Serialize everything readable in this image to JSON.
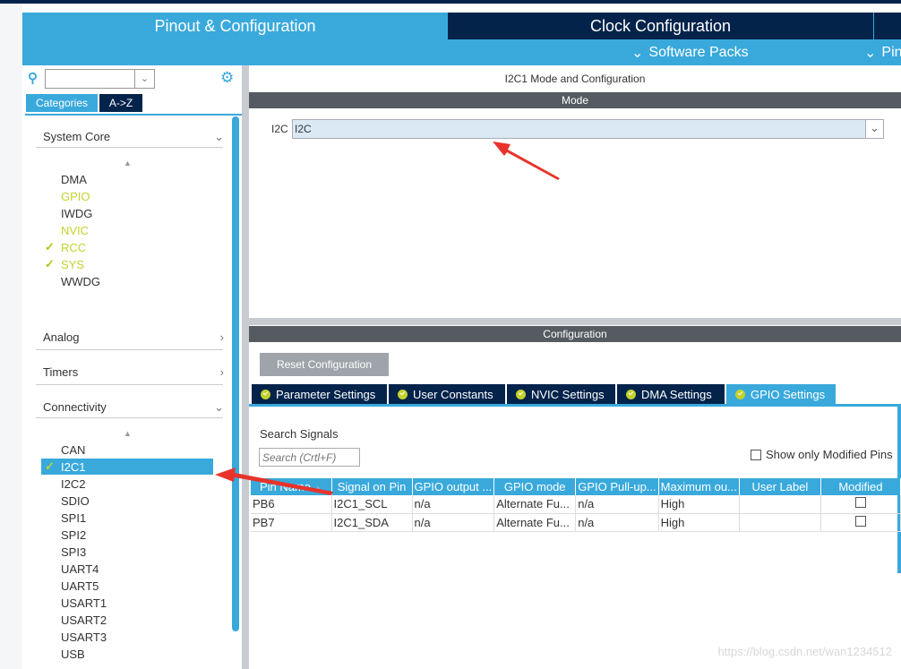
{
  "header": {
    "tabs": [
      {
        "label": "Pinout & Configuration",
        "active": true
      },
      {
        "label": "Clock Configuration",
        "active": false
      }
    ],
    "submenus": [
      "Software Packs",
      "Pin"
    ]
  },
  "left": {
    "search": {
      "value": "",
      "placeholder": ""
    },
    "view_tabs": [
      "Categories",
      "A->Z"
    ],
    "groups": [
      {
        "label": "System Core",
        "expanded": true,
        "items": [
          {
            "label": "DMA",
            "state": "normal"
          },
          {
            "label": "GPIO",
            "state": "partial"
          },
          {
            "label": "IWDG",
            "state": "normal"
          },
          {
            "label": "NVIC",
            "state": "partial"
          },
          {
            "label": "RCC",
            "state": "checked"
          },
          {
            "label": "SYS",
            "state": "checked"
          },
          {
            "label": "WWDG",
            "state": "normal"
          }
        ]
      },
      {
        "label": "Analog",
        "expanded": false
      },
      {
        "label": "Timers",
        "expanded": false
      },
      {
        "label": "Connectivity",
        "expanded": true,
        "items": [
          {
            "label": "CAN"
          },
          {
            "label": "I2C1",
            "selected": true,
            "checked": true
          },
          {
            "label": "I2C2"
          },
          {
            "label": "SDIO"
          },
          {
            "label": "SPI1"
          },
          {
            "label": "SPI2"
          },
          {
            "label": "SPI3"
          },
          {
            "label": "UART4"
          },
          {
            "label": "UART5"
          },
          {
            "label": "USART1"
          },
          {
            "label": "USART2"
          },
          {
            "label": "USART3"
          },
          {
            "label": "USB"
          }
        ]
      }
    ]
  },
  "main": {
    "title": "I2C1 Mode and Configuration",
    "mode_header": "Mode",
    "mode_label": "I2C",
    "mode_value": "I2C",
    "config_header": "Configuration",
    "reset_button": "Reset Configuration",
    "tabs": [
      "Parameter Settings",
      "User Constants",
      "NVIC Settings",
      "DMA Settings",
      "GPIO Settings"
    ],
    "active_tab": "GPIO Settings",
    "search_label": "Search Signals",
    "search_placeholder": "Search (Crtl+F)",
    "show_modified": "Show only Modified Pins",
    "columns": [
      "Pin Name",
      "Signal on Pin",
      "GPIO output ...",
      "GPIO mode",
      "GPIO Pull-up...",
      "Maximum ou...",
      "User Label",
      "Modified"
    ],
    "rows": [
      [
        "PB6",
        "I2C1_SCL",
        "n/a",
        "Alternate Fu...",
        "n/a",
        "High",
        "",
        false
      ],
      [
        "PB7",
        "I2C1_SDA",
        "n/a",
        "Alternate Fu...",
        "n/a",
        "High",
        "",
        false
      ]
    ]
  },
  "watermark": "https://blog.csdn.net/wan1234512",
  "colors": {
    "accent": "#39a9dc",
    "navy": "#03234b",
    "enabled": "#c3d22d",
    "arrow": "#e8332a"
  }
}
